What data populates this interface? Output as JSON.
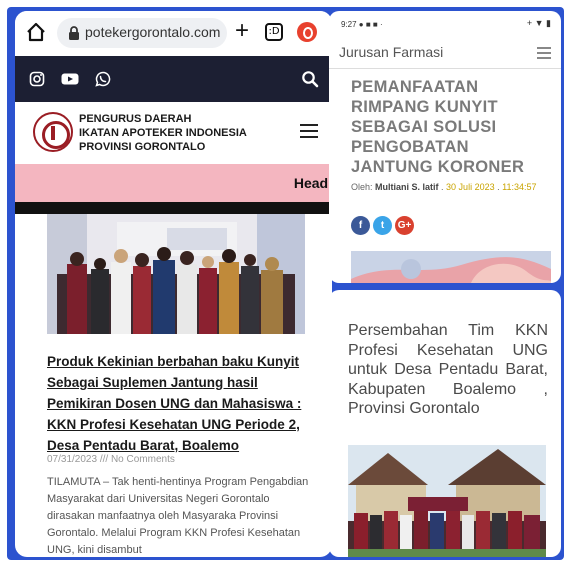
{
  "left": {
    "browser": {
      "url": "potekergorontalo.com",
      "plus": "+",
      "tab_count": ":D"
    },
    "header": {
      "org_line1": "PENGURUS DAERAH",
      "org_line2": "IKATAN APOTEKER INDONESIA",
      "org_line3": "PROVINSI GORONTALO"
    },
    "headline_label": "Headl",
    "article": {
      "title": "Produk Kekinian berbahan baku Kunyit Sebagai Suplemen Jantung hasil Pemikiran Dosen UNG dan Mahasiswa : KKN Profesi Kesehatan UNG Periode 2, Desa Pentadu Barat, Boalemo",
      "meta": "07/31/2023 /// No Comments",
      "excerpt": "TILAMUTA – Tak henti-hentinya Program Pengabdian Masyarakat dari Universitas Negeri Gorontalo dirasakan manfaatnya oleh Masyaraka Provinsi Gorontalo. Melalui Program KKN Profesi Kesehatan UNG, kini disambut"
    }
  },
  "right_top": {
    "status_time": "9:27",
    "site_name": "Jurusan Farmasi",
    "title": "PEMANFAATAN RIMPANG KUNYIT SEBAGAI SOLUSI PENGOBATAN JANTUNG KORONER",
    "byline_prefix": "Oleh: ",
    "author": "Multiani S. latif",
    "separator": " . ",
    "date": "30 Juli 2023",
    "time": "11:34:57",
    "share_google": "G+"
  },
  "right_bottom": {
    "title": "Persembahan Tim KKN Profesi Kesehatan UNG untuk Desa Pentadu Barat, Kabupaten Boalemo , Provinsi Gorontalo"
  },
  "colors": {
    "frame": "#2c53cf",
    "social_bar": "#1c1f33",
    "headline_strip": "#f4b6c0",
    "facebook": "#3b5998",
    "twitter": "#3aa4e8",
    "google": "#d9412f",
    "date_accent": "#c9a400"
  }
}
